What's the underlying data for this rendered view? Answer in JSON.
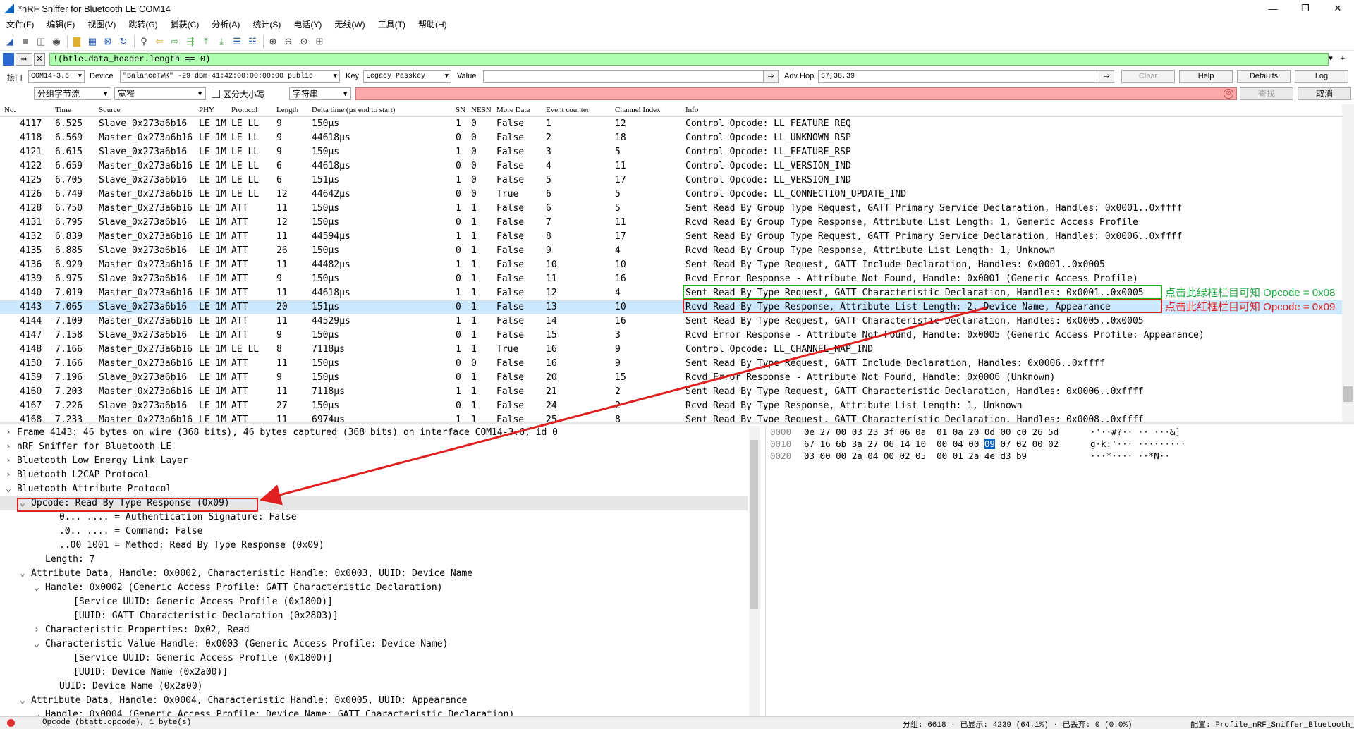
{
  "window": {
    "title": "*nRF Sniffer for Bluetooth LE COM14",
    "controls": [
      "—",
      "❐",
      "✕"
    ]
  },
  "menu": [
    "文件(F)",
    "编辑(E)",
    "视图(V)",
    "跳转(G)",
    "捕获(C)",
    "分析(A)",
    "统计(S)",
    "电话(Y)",
    "无线(W)",
    "工具(T)",
    "帮助(H)"
  ],
  "filter": {
    "value": "!(btle.data_header.length == 0)"
  },
  "nrf": {
    "iface_label": "接口",
    "iface_value": "COM14-3.6",
    "device_label": "Device",
    "device_value": "\"BalanceTWK\"  -29 dBm  41:42:00:00:00:00  public",
    "key_label": "Key",
    "key_value": "Legacy Passkey",
    "value_label": "Value",
    "value_value": "",
    "adv_hop_label": "Adv Hop",
    "adv_hop_value": "37,38,39",
    "clear_label": "Clear",
    "help_label": "Help",
    "defaults_label": "Defaults",
    "log_label": "Log"
  },
  "find": {
    "scope": "分组字节流",
    "width": "宽窄",
    "case_label": "区分大小写",
    "type": "字符串",
    "find_btn": "查找",
    "cancel_btn": "取消"
  },
  "columns": [
    "No.",
    "Time",
    "Source",
    "PHY",
    "Protocol",
    "Length",
    "Delta time (µs end to start)",
    "SN",
    "NESN",
    "More Data",
    "Event counter",
    "Channel Index",
    "Info"
  ],
  "packets": [
    {
      "no": "4117",
      "time": "6.525",
      "src": "Slave_0x273a6b16",
      "phy": "LE 1M",
      "proto": "LE LL",
      "len": "9",
      "delta": "150µs",
      "sn": "1",
      "nesn": "0",
      "more": "False",
      "ev": "1",
      "ch": "12",
      "info": "Control Opcode: LL_FEATURE_REQ"
    },
    {
      "no": "4118",
      "time": "6.569",
      "src": "Master_0x273a6b16",
      "phy": "LE 1M",
      "proto": "LE LL",
      "len": "9",
      "delta": "44618µs",
      "sn": "0",
      "nesn": "0",
      "more": "False",
      "ev": "2",
      "ch": "18",
      "info": "Control Opcode: LL_UNKNOWN_RSP"
    },
    {
      "no": "4121",
      "time": "6.615",
      "src": "Slave_0x273a6b16",
      "phy": "LE 1M",
      "proto": "LE LL",
      "len": "9",
      "delta": "150µs",
      "sn": "1",
      "nesn": "0",
      "more": "False",
      "ev": "3",
      "ch": "5",
      "info": "Control Opcode: LL_FEATURE_RSP"
    },
    {
      "no": "4122",
      "time": "6.659",
      "src": "Master_0x273a6b16",
      "phy": "LE 1M",
      "proto": "LE LL",
      "len": "6",
      "delta": "44618µs",
      "sn": "0",
      "nesn": "0",
      "more": "False",
      "ev": "4",
      "ch": "11",
      "info": "Control Opcode: LL_VERSION_IND"
    },
    {
      "no": "4125",
      "time": "6.705",
      "src": "Slave_0x273a6b16",
      "phy": "LE 1M",
      "proto": "LE LL",
      "len": "6",
      "delta": "151µs",
      "sn": "1",
      "nesn": "0",
      "more": "False",
      "ev": "5",
      "ch": "17",
      "info": "Control Opcode: LL_VERSION_IND"
    },
    {
      "no": "4126",
      "time": "6.749",
      "src": "Master_0x273a6b16",
      "phy": "LE 1M",
      "proto": "LE LL",
      "len": "12",
      "delta": "44642µs",
      "sn": "0",
      "nesn": "0",
      "more": "True",
      "ev": "6",
      "ch": "5",
      "info": "Control Opcode: LL_CONNECTION_UPDATE_IND"
    },
    {
      "no": "4128",
      "time": "6.750",
      "src": "Master_0x273a6b16",
      "phy": "LE 1M",
      "proto": "ATT",
      "len": "11",
      "delta": "150µs",
      "sn": "1",
      "nesn": "1",
      "more": "False",
      "ev": "6",
      "ch": "5",
      "info": "Sent Read By Group Type Request, GATT Primary Service Declaration, Handles: 0x0001..0xffff"
    },
    {
      "no": "4131",
      "time": "6.795",
      "src": "Slave_0x273a6b16",
      "phy": "LE 1M",
      "proto": "ATT",
      "len": "12",
      "delta": "150µs",
      "sn": "0",
      "nesn": "1",
      "more": "False",
      "ev": "7",
      "ch": "11",
      "info": "Rcvd Read By Group Type Response, Attribute List Length: 1, Generic Access Profile"
    },
    {
      "no": "4132",
      "time": "6.839",
      "src": "Master_0x273a6b16",
      "phy": "LE 1M",
      "proto": "ATT",
      "len": "11",
      "delta": "44594µs",
      "sn": "1",
      "nesn": "1",
      "more": "False",
      "ev": "8",
      "ch": "17",
      "info": "Sent Read By Group Type Request, GATT Primary Service Declaration, Handles: 0x0006..0xffff"
    },
    {
      "no": "4135",
      "time": "6.885",
      "src": "Slave_0x273a6b16",
      "phy": "LE 1M",
      "proto": "ATT",
      "len": "26",
      "delta": "150µs",
      "sn": "0",
      "nesn": "1",
      "more": "False",
      "ev": "9",
      "ch": "4",
      "info": "Rcvd Read By Group Type Response, Attribute List Length: 1, Unknown"
    },
    {
      "no": "4136",
      "time": "6.929",
      "src": "Master_0x273a6b16",
      "phy": "LE 1M",
      "proto": "ATT",
      "len": "11",
      "delta": "44482µs",
      "sn": "1",
      "nesn": "1",
      "more": "False",
      "ev": "10",
      "ch": "10",
      "info": "Sent Read By Type Request, GATT Include Declaration, Handles: 0x0001..0x0005"
    },
    {
      "no": "4139",
      "time": "6.975",
      "src": "Slave_0x273a6b16",
      "phy": "LE 1M",
      "proto": "ATT",
      "len": "9",
      "delta": "150µs",
      "sn": "0",
      "nesn": "1",
      "more": "False",
      "ev": "11",
      "ch": "16",
      "info": "Rcvd Error Response - Attribute Not Found, Handle: 0x0001 (Generic Access Profile)"
    },
    {
      "no": "4140",
      "time": "7.019",
      "src": "Master_0x273a6b16",
      "phy": "LE 1M",
      "proto": "ATT",
      "len": "11",
      "delta": "44618µs",
      "sn": "1",
      "nesn": "1",
      "more": "False",
      "ev": "12",
      "ch": "4",
      "info": "Sent Read By Type Request, GATT Characteristic Declaration, Handles: 0x0001..0x0005"
    },
    {
      "no": "4143",
      "time": "7.065",
      "src": "Slave_0x273a6b16",
      "phy": "LE 1M",
      "proto": "ATT",
      "len": "20",
      "delta": "151µs",
      "sn": "0",
      "nesn": "1",
      "more": "False",
      "ev": "13",
      "ch": "10",
      "info": "Rcvd Read By Type Response, Attribute List Length: 2, Device Name, Appearance"
    },
    {
      "no": "4144",
      "time": "7.109",
      "src": "Master_0x273a6b16",
      "phy": "LE 1M",
      "proto": "ATT",
      "len": "11",
      "delta": "44529µs",
      "sn": "1",
      "nesn": "1",
      "more": "False",
      "ev": "14",
      "ch": "16",
      "info": "Sent Read By Type Request, GATT Characteristic Declaration, Handles: 0x0005..0x0005"
    },
    {
      "no": "4147",
      "time": "7.158",
      "src": "Slave_0x273a6b16",
      "phy": "LE 1M",
      "proto": "ATT",
      "len": "9",
      "delta": "150µs",
      "sn": "0",
      "nesn": "1",
      "more": "False",
      "ev": "15",
      "ch": "3",
      "info": "Rcvd Error Response - Attribute Not Found, Handle: 0x0005 (Generic Access Profile: Appearance)"
    },
    {
      "no": "4148",
      "time": "7.166",
      "src": "Master_0x273a6b16",
      "phy": "LE 1M",
      "proto": "LE LL",
      "len": "8",
      "delta": "7118µs",
      "sn": "1",
      "nesn": "1",
      "more": "True",
      "ev": "16",
      "ch": "9",
      "info": "Control Opcode: LL_CHANNEL_MAP_IND"
    },
    {
      "no": "4150",
      "time": "7.166",
      "src": "Master_0x273a6b16",
      "phy": "LE 1M",
      "proto": "ATT",
      "len": "11",
      "delta": "150µs",
      "sn": "0",
      "nesn": "0",
      "more": "False",
      "ev": "16",
      "ch": "9",
      "info": "Sent Read By Type Request, GATT Include Declaration, Handles: 0x0006..0xffff"
    },
    {
      "no": "4159",
      "time": "7.196",
      "src": "Slave_0x273a6b16",
      "phy": "LE 1M",
      "proto": "ATT",
      "len": "9",
      "delta": "150µs",
      "sn": "0",
      "nesn": "1",
      "more": "False",
      "ev": "20",
      "ch": "15",
      "info": "Rcvd Error Response - Attribute Not Found, Handle: 0x0006 (Unknown)"
    },
    {
      "no": "4160",
      "time": "7.203",
      "src": "Master_0x273a6b16",
      "phy": "LE 1M",
      "proto": "ATT",
      "len": "11",
      "delta": "7118µs",
      "sn": "1",
      "nesn": "1",
      "more": "False",
      "ev": "21",
      "ch": "2",
      "info": "Sent Read By Type Request, GATT Characteristic Declaration, Handles: 0x0006..0xffff"
    },
    {
      "no": "4167",
      "time": "7.226",
      "src": "Slave_0x273a6b16",
      "phy": "LE 1M",
      "proto": "ATT",
      "len": "27",
      "delta": "150µs",
      "sn": "0",
      "nesn": "1",
      "more": "False",
      "ev": "24",
      "ch": "2",
      "info": "Rcvd Read By Type Response, Attribute List Length: 1, Unknown"
    },
    {
      "no": "4168",
      "time": "7.233",
      "src": "Master_0x273a6b16",
      "phy": "LE 1M",
      "proto": "ATT",
      "len": "11",
      "delta": "6974µs",
      "sn": "1",
      "nesn": "1",
      "more": "False",
      "ev": "25",
      "ch": "8",
      "info": "Sent Read By Type Request, GATT Characteristic Declaration, Handles: 0x0008..0xffff"
    }
  ],
  "annotations": {
    "green_note": "点击此绿框栏目可知 Opcode = 0x08",
    "red_note": "点击此红框栏目可知 Opcode = 0x09"
  },
  "tree": [
    {
      "indent": 0,
      "exp": "›",
      "text": "Frame 4143: 46 bytes on wire (368 bits), 46 bytes captured (368 bits) on interface COM14-3.6, id 0"
    },
    {
      "indent": 0,
      "exp": "›",
      "text": "nRF Sniffer for Bluetooth LE"
    },
    {
      "indent": 0,
      "exp": "›",
      "text": "Bluetooth Low Energy Link Layer"
    },
    {
      "indent": 0,
      "exp": "›",
      "text": "Bluetooth L2CAP Protocol"
    },
    {
      "indent": 0,
      "exp": "⌄",
      "text": "Bluetooth Attribute Protocol"
    },
    {
      "indent": 1,
      "exp": "⌄",
      "text": "Opcode: Read By Type Response (0x09)"
    },
    {
      "indent": 3,
      "exp": "",
      "text": "0... .... = Authentication Signature: False"
    },
    {
      "indent": 3,
      "exp": "",
      "text": ".0.. .... = Command: False"
    },
    {
      "indent": 3,
      "exp": "",
      "text": "..00 1001 = Method: Read By Type Response (0x09)"
    },
    {
      "indent": 2,
      "exp": "",
      "text": "Length: 7"
    },
    {
      "indent": 1,
      "exp": "⌄",
      "text": "Attribute Data, Handle: 0x0002, Characteristic Handle: 0x0003, UUID: Device Name"
    },
    {
      "indent": 2,
      "exp": "⌄",
      "text": "Handle: 0x0002 (Generic Access Profile: GATT Characteristic Declaration)"
    },
    {
      "indent": 4,
      "exp": "",
      "text": "[Service UUID: Generic Access Profile (0x1800)]"
    },
    {
      "indent": 4,
      "exp": "",
      "text": "[UUID: GATT Characteristic Declaration (0x2803)]"
    },
    {
      "indent": 2,
      "exp": "›",
      "text": "Characteristic Properties: 0x02, Read"
    },
    {
      "indent": 2,
      "exp": "⌄",
      "text": "Characteristic Value Handle: 0x0003 (Generic Access Profile: Device Name)"
    },
    {
      "indent": 4,
      "exp": "",
      "text": "[Service UUID: Generic Access Profile (0x1800)]"
    },
    {
      "indent": 4,
      "exp": "",
      "text": "[UUID: Device Name (0x2a00)]"
    },
    {
      "indent": 3,
      "exp": "",
      "text": "UUID: Device Name (0x2a00)"
    },
    {
      "indent": 1,
      "exp": "⌄",
      "text": "Attribute Data, Handle: 0x0004, Characteristic Handle: 0x0005, UUID: Appearance"
    },
    {
      "indent": 2,
      "exp": "⌄",
      "text": "Handle: 0x0004 (Generic Access Profile: Device Name: GATT Characteristic Declaration)"
    }
  ],
  "hex": [
    {
      "off": "0000",
      "pre": "0e 27 00 03 23 3f 06 0a  01 0a 20 0d 00 c0 26 5d",
      "sel": "",
      "post": "",
      "ascii": "·'··#?·· ·· ···&]"
    },
    {
      "off": "0010",
      "pre": "67 16 6b 3a 27 06 14 10  00 04 00 ",
      "sel": "09",
      "post": " 07 02 00 02",
      "ascii": "g·k:'··· ·········"
    },
    {
      "off": "0020",
      "pre": "03 00 00 2a 04 00 02 05  00 01 2a 4e d3 b9",
      "sel": "",
      "post": "",
      "ascii": "···*···· ··*N··"
    }
  ],
  "status": {
    "left": "Opcode (btatt.opcode), 1 byte(s)",
    "middle": "分组: 6618 · 已显示: 4239 (64.1%) · 已丢弃: 0 (0.0%)",
    "right": "配置: Profile_nRF_Sniffer_Bluetooth_LE"
  }
}
